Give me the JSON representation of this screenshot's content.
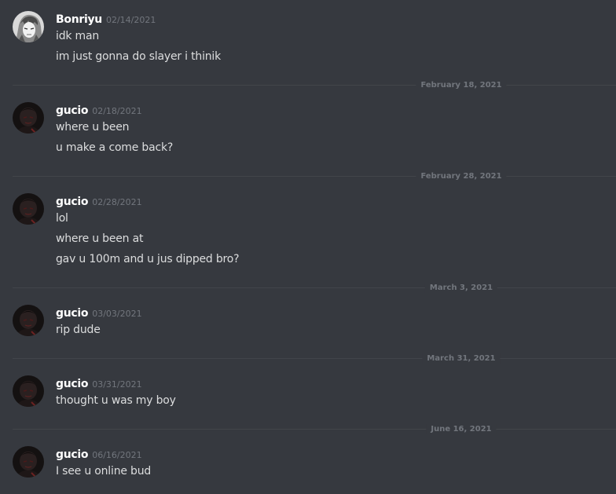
{
  "messages": [
    {
      "username": "Bonriyu",
      "timestamp": "02/14/2021",
      "lines": [
        "idk man",
        "im just gonna do slayer i thinik"
      ],
      "avatar": "anime-character-avatar"
    },
    {
      "divider": "February 18, 2021"
    },
    {
      "username": "gucio",
      "timestamp": "02/18/2021",
      "lines": [
        "where u been",
        "u make a come back?"
      ],
      "avatar": "dark-portrait-avatar"
    },
    {
      "divider": "February 28, 2021"
    },
    {
      "username": "gucio",
      "timestamp": "02/28/2021",
      "lines": [
        "lol",
        "where u been at",
        "gav u 100m and u jus dipped bro?"
      ],
      "avatar": "dark-portrait-avatar"
    },
    {
      "divider": "March 3, 2021"
    },
    {
      "username": "gucio",
      "timestamp": "03/03/2021",
      "lines": [
        "rip dude"
      ],
      "avatar": "dark-portrait-avatar"
    },
    {
      "divider": "March 31, 2021"
    },
    {
      "username": "gucio",
      "timestamp": "03/31/2021",
      "lines": [
        "thought u was my boy"
      ],
      "avatar": "dark-portrait-avatar"
    },
    {
      "divider": "June 16, 2021"
    },
    {
      "username": "gucio",
      "timestamp": "06/16/2021",
      "lines": [
        "I see u online bud"
      ],
      "avatar": "dark-portrait-avatar"
    }
  ],
  "colors": {
    "background": "#36393f",
    "username": "#ffffff",
    "timestamp": "#72767d",
    "message_text": "#dcddde",
    "divider_line": "#42454a"
  }
}
